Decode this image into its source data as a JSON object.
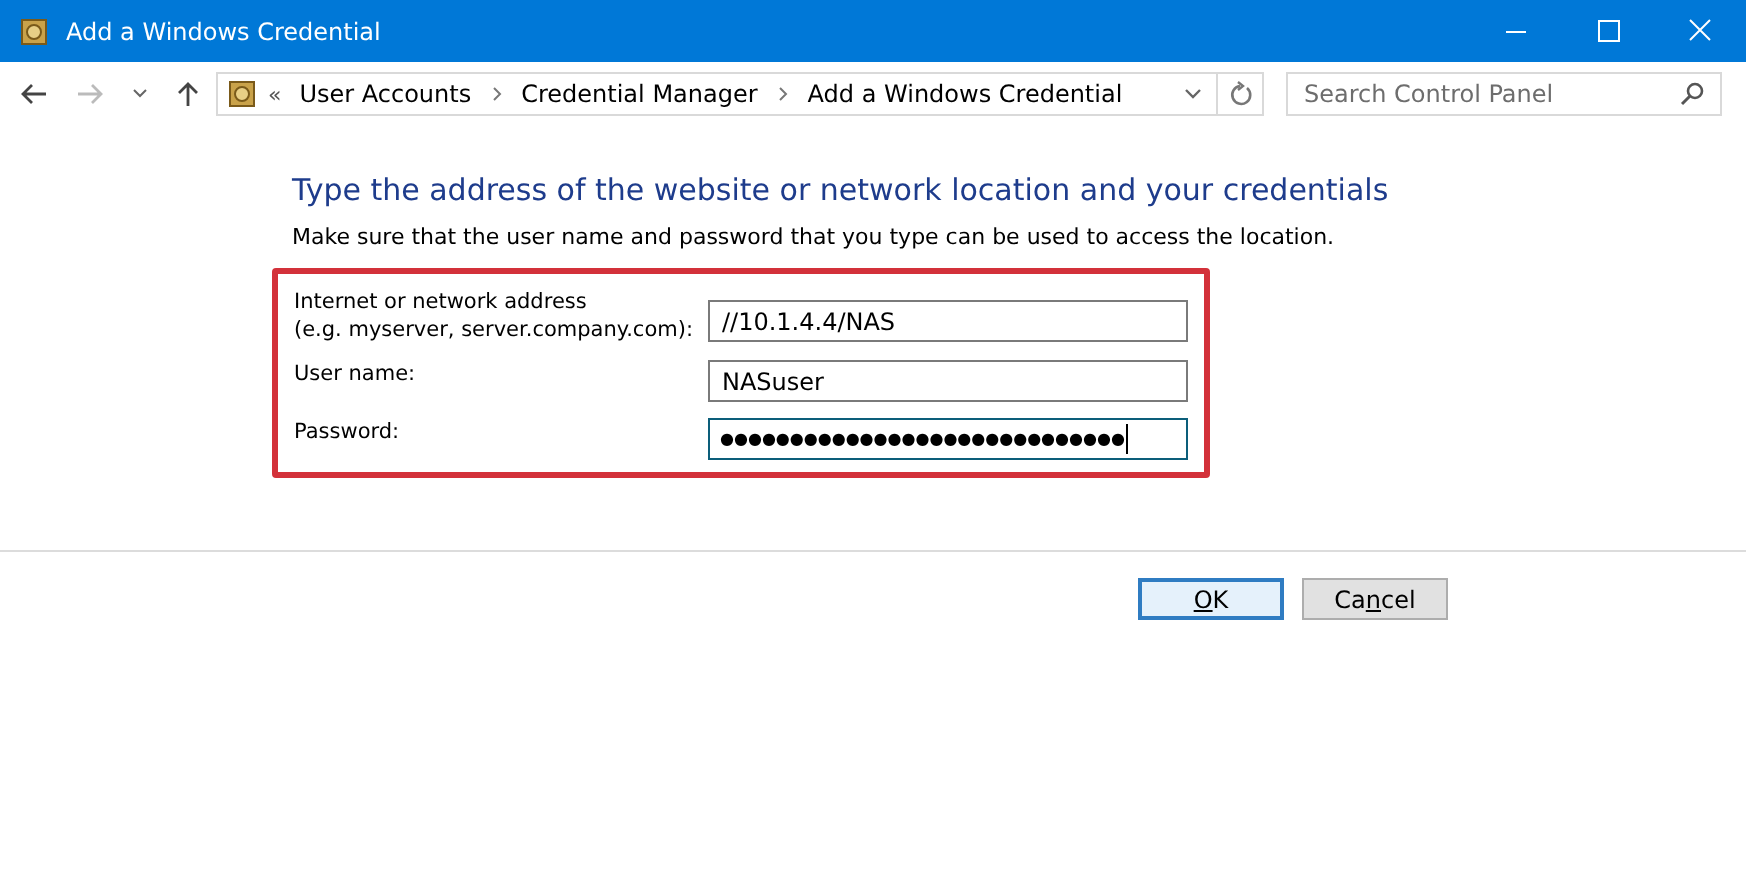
{
  "window": {
    "title": "Add a Windows Credential"
  },
  "nav": {
    "back_enabled": true,
    "forward_enabled": false,
    "breadcrumb_overflow": "«",
    "breadcrumbs": [
      "User Accounts",
      "Credential Manager",
      "Add a Windows Credential"
    ],
    "search_placeholder": "Search Control Panel"
  },
  "heading": "Type the address of the website or network location and your credentials",
  "description": "Make sure that the user name and password that you type can be used to access the location.",
  "form": {
    "highlighted": true,
    "fields": [
      {
        "label": "Internet or network address\n(e.g. myserver, server.company.com):",
        "value": "//10.1.4.4/NAS",
        "focused": false
      },
      {
        "label": "User name:",
        "value": "NASuser",
        "focused": false
      },
      {
        "label": "Password:",
        "value": "●●●●●●●●●●●●●●●●●●●●●●●●●●●●●",
        "focused": true
      }
    ]
  },
  "buttons": [
    {
      "mnemonic": "O",
      "after": "K",
      "default": true
    },
    {
      "before": "Ca",
      "mnemonic": "n",
      "after": "cel",
      "default": false
    }
  ]
}
